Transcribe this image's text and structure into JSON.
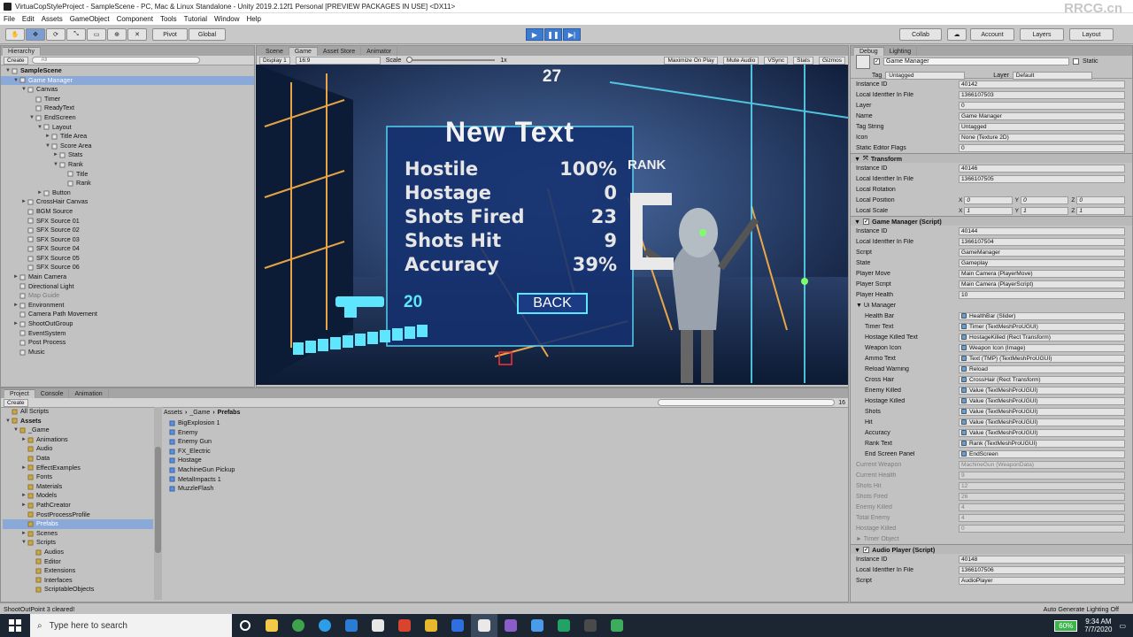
{
  "window": {
    "title": "VirtuaCopStyleProject - SampleScene - PC, Mac & Linux Standalone - Unity 2019.2.12f1 Personal [PREVIEW PACKAGES IN USE] <DX11>",
    "watermark": "RRCG.cn"
  },
  "menu": [
    "File",
    "Edit",
    "Assets",
    "GameObject",
    "Component",
    "Tools",
    "Tutorial",
    "Window",
    "Help"
  ],
  "toolbar": {
    "pivot": "Pivot",
    "global": "Global",
    "collab": "Collab",
    "account": "Account",
    "layers": "Layers",
    "layout": "Layout"
  },
  "hierarchy": {
    "tab": "Hierarchy",
    "create": "Create",
    "search_placeholder": "All",
    "items": [
      {
        "label": "SampleScene",
        "depth": 0,
        "arrow": "▼",
        "bold": true
      },
      {
        "label": "Game Manager",
        "depth": 1,
        "arrow": "▼",
        "selected": true
      },
      {
        "label": "Canvas",
        "depth": 2,
        "arrow": "▼"
      },
      {
        "label": "Timer",
        "depth": 3,
        "arrow": ""
      },
      {
        "label": "ReadyText",
        "depth": 3,
        "arrow": ""
      },
      {
        "label": "EndScreen",
        "depth": 3,
        "arrow": "▼"
      },
      {
        "label": "Layout",
        "depth": 4,
        "arrow": "▼"
      },
      {
        "label": "Title Area",
        "depth": 5,
        "arrow": "►"
      },
      {
        "label": "Score Area",
        "depth": 5,
        "arrow": "▼"
      },
      {
        "label": "Stats",
        "depth": 6,
        "arrow": "►"
      },
      {
        "label": "Rank",
        "depth": 6,
        "arrow": "▼"
      },
      {
        "label": "Title",
        "depth": 7,
        "arrow": ""
      },
      {
        "label": "Rank",
        "depth": 7,
        "arrow": ""
      },
      {
        "label": "Button",
        "depth": 4,
        "arrow": "►"
      },
      {
        "label": "CrossHair Canvas",
        "depth": 2,
        "arrow": "►"
      },
      {
        "label": "BGM Source",
        "depth": 2,
        "arrow": ""
      },
      {
        "label": "SFX Source 01",
        "depth": 2,
        "arrow": ""
      },
      {
        "label": "SFX Source 02",
        "depth": 2,
        "arrow": ""
      },
      {
        "label": "SFX Source 03",
        "depth": 2,
        "arrow": ""
      },
      {
        "label": "SFX Source 04",
        "depth": 2,
        "arrow": ""
      },
      {
        "label": "SFX Source 05",
        "depth": 2,
        "arrow": ""
      },
      {
        "label": "SFX Source 06",
        "depth": 2,
        "arrow": ""
      },
      {
        "label": "Main Camera",
        "depth": 1,
        "arrow": "►"
      },
      {
        "label": "Directional Light",
        "depth": 1,
        "arrow": ""
      },
      {
        "label": "Map Guide",
        "depth": 1,
        "arrow": "",
        "dim": true
      },
      {
        "label": "Environment",
        "depth": 1,
        "arrow": "►"
      },
      {
        "label": "Camera Path Movement",
        "depth": 1,
        "arrow": ""
      },
      {
        "label": "ShootOutGroup",
        "depth": 1,
        "arrow": "►"
      },
      {
        "label": "EventSystem",
        "depth": 1,
        "arrow": ""
      },
      {
        "label": "Post Process",
        "depth": 1,
        "arrow": ""
      },
      {
        "label": "Music",
        "depth": 1,
        "arrow": ""
      }
    ]
  },
  "scene_tabs": [
    "Scene",
    "Game",
    "Asset Store",
    "Animator"
  ],
  "game_bar": {
    "display": "Display 1",
    "aspect": "16:9",
    "scale_label": "Scale",
    "scale_value": "1x",
    "options": [
      "Maximize On Play",
      "Mute Audio",
      "VSync",
      "Stats",
      "Gizmos"
    ]
  },
  "game": {
    "timer": "27",
    "title": "New Text",
    "stats": [
      {
        "label": "Hostile",
        "value": "100%"
      },
      {
        "label": "Hostage",
        "value": "0"
      },
      {
        "label": "Shots Fired",
        "value": "23"
      },
      {
        "label": "Shots Hit",
        "value": "9"
      },
      {
        "label": "Accuracy",
        "value": "39%"
      }
    ],
    "rank_label": "RANK",
    "rank_value": "C",
    "back": "BACK",
    "ammo": "20"
  },
  "project": {
    "tabs": [
      "Project",
      "Console",
      "Animation"
    ],
    "create": "Create",
    "breadcrumb": [
      "Assets",
      "_Game",
      "Prefabs"
    ],
    "count": "16",
    "tree": [
      {
        "label": "All Scripts",
        "depth": 0,
        "arrow": ""
      },
      {
        "label": "Assets",
        "depth": 0,
        "arrow": "▼",
        "bold": true
      },
      {
        "label": "_Game",
        "depth": 1,
        "arrow": "▼"
      },
      {
        "label": "Animations",
        "depth": 2,
        "arrow": "►"
      },
      {
        "label": "Audio",
        "depth": 2,
        "arrow": ""
      },
      {
        "label": "Data",
        "depth": 2,
        "arrow": ""
      },
      {
        "label": "EffectExamples",
        "depth": 2,
        "arrow": "►"
      },
      {
        "label": "Fonts",
        "depth": 2,
        "arrow": ""
      },
      {
        "label": "Materials",
        "depth": 2,
        "arrow": ""
      },
      {
        "label": "Models",
        "depth": 2,
        "arrow": "►"
      },
      {
        "label": "PathCreator",
        "depth": 2,
        "arrow": "►"
      },
      {
        "label": "PostProcessProfile",
        "depth": 2,
        "arrow": ""
      },
      {
        "label": "Prefabs",
        "depth": 2,
        "arrow": "",
        "selected": true
      },
      {
        "label": "Scenes",
        "depth": 2,
        "arrow": "►"
      },
      {
        "label": "Scripts",
        "depth": 2,
        "arrow": "▼"
      },
      {
        "label": "Audios",
        "depth": 3,
        "arrow": ""
      },
      {
        "label": "Editor",
        "depth": 3,
        "arrow": ""
      },
      {
        "label": "Extensions",
        "depth": 3,
        "arrow": ""
      },
      {
        "label": "Interfaces",
        "depth": 3,
        "arrow": ""
      },
      {
        "label": "ScriptableObjects",
        "depth": 3,
        "arrow": ""
      }
    ],
    "files": [
      "BigExplosion 1",
      "Enemy",
      "Enemy Gun",
      "FX_Electric",
      "Hostage",
      "MachineGun Pickup",
      "MetalImpacts 1",
      "MuzzleFlash"
    ]
  },
  "inspector": {
    "tabs": [
      "Debug",
      "Lighting"
    ],
    "object_name": "Game Manager",
    "static_label": "Static",
    "tag_label": "Tag",
    "tag_value": "Untagged",
    "layer_label": "Layer",
    "layer_value": "Default",
    "go_rows": [
      [
        "Instance ID",
        "40142"
      ],
      [
        "Local Identfier In File",
        "1366107503"
      ],
      [
        "Layer",
        "0"
      ],
      [
        "Name",
        "Game Manager"
      ],
      [
        "Tag String",
        "Untagged"
      ],
      [
        "Icon",
        "None (Texture 2D)"
      ],
      [
        "Static Editor Flags",
        "0"
      ]
    ],
    "transform": {
      "title": "Transform",
      "rows": [
        [
          "Instance ID",
          "40146"
        ],
        [
          "Local Identfier In File",
          "1366107505"
        ]
      ],
      "rotation": "Local Rotation",
      "position": {
        "label": "Local Position",
        "x": "0",
        "y": "0",
        "z": "0"
      },
      "scale": {
        "label": "Local Scale",
        "x": "1",
        "y": "1",
        "z": "1"
      }
    },
    "game_manager": {
      "title": "Game Manager (Script)",
      "rows": [
        [
          "Instance ID",
          "40144"
        ],
        [
          "Local Identfier In File",
          "1366107504"
        ],
        [
          "Script",
          "GameManager"
        ],
        [
          "State",
          "Gameplay"
        ],
        [
          "Player Move",
          "Main Camera (PlayerMove)"
        ],
        [
          "Player Script",
          "Main Camera (PlayerScript)"
        ],
        [
          "Player Health",
          "10"
        ]
      ],
      "ui_manager_label": "Ui Manager",
      "ui_rows": [
        [
          "Health Bar",
          "HealthBar (Slider)"
        ],
        [
          "Timer Text",
          "Timer (TextMeshProUGUI)"
        ],
        [
          "Hostage Killed Text",
          "HostageKilled (Rect Transform)"
        ],
        [
          "Weapon Icon",
          "Weapon Icon (Image)"
        ],
        [
          "Ammo Text",
          "Text (TMP) (TextMeshProUGUI)"
        ],
        [
          "Reload Warning",
          "Reload"
        ],
        [
          "Cross Hair",
          "CrossHair (Rect Transform)"
        ],
        [
          "Enemy Killed",
          "Value (TextMeshProUGUI)"
        ],
        [
          "Hostage Killed",
          "Value (TextMeshProUGUI)"
        ],
        [
          "Shots",
          "Value (TextMeshProUGUI)"
        ],
        [
          "Hit",
          "Value (TextMeshProUGUI)"
        ],
        [
          "Accuracy",
          "Value (TextMeshProUGUI)"
        ],
        [
          "Rank Text",
          "Rank (TextMeshProUGUI)"
        ],
        [
          "End Screen Panel",
          "EndScreen"
        ]
      ],
      "dim_rows": [
        [
          "Current Weapon",
          "MachineGun (WeaponData)"
        ],
        [
          "Current Health",
          "9"
        ],
        [
          "Shots Hit",
          "12"
        ],
        [
          "Shots Fired",
          "26"
        ],
        [
          "Enemy Killed",
          "4"
        ],
        [
          "Total Enemy",
          "4"
        ],
        [
          "Hostage Killed",
          "0"
        ]
      ],
      "timer_object": "Timer Object"
    },
    "audio_player": {
      "title": "Audio Player (Script)",
      "rows": [
        [
          "Instance ID",
          "40148"
        ],
        [
          "Local Identfier In File",
          "1366107506"
        ],
        [
          "Script",
          "AudioPlayer"
        ]
      ]
    }
  },
  "status": {
    "message": "ShootOutPoint 3 cleared!",
    "lighting": "Auto Generate Lighting Off"
  },
  "taskbar": {
    "search_placeholder": "Type here to search",
    "battery": "60%",
    "time": "9:34 AM",
    "date": "7/7/2020"
  },
  "colors": {
    "play_blue": "#3d7bd1",
    "selection": "#8aa9d9",
    "neon_cyan": "#5ee6ff",
    "neon_orange": "#ffb347"
  }
}
